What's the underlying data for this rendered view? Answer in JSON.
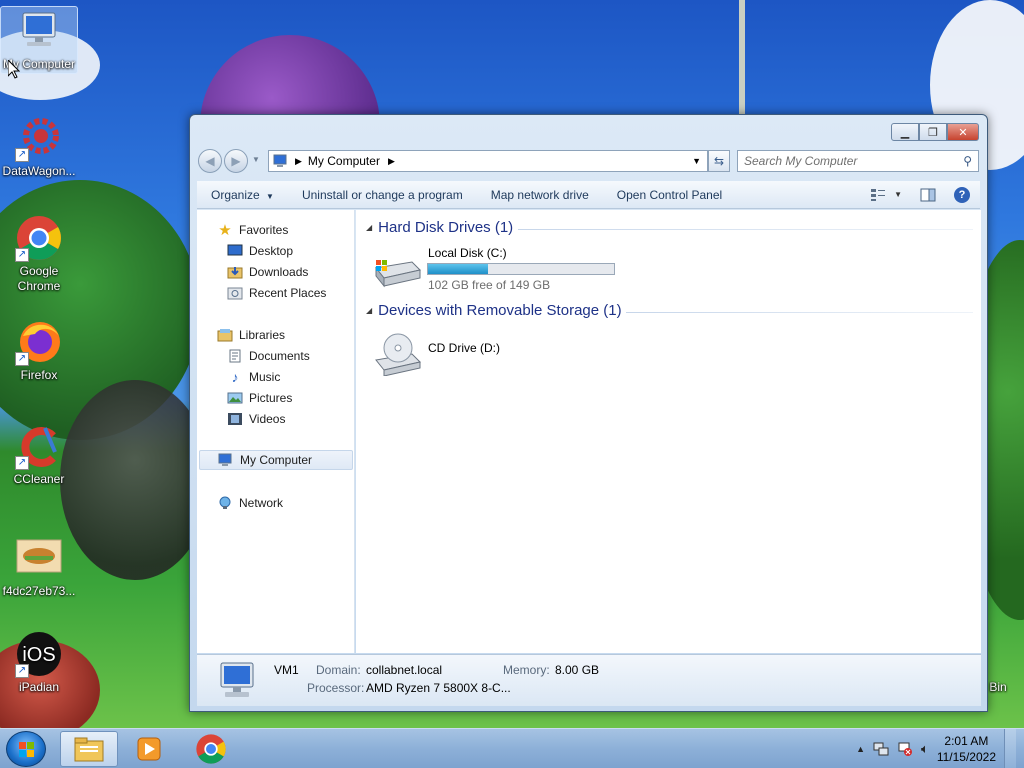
{
  "desktop": {
    "icons": [
      {
        "label": "My Computer"
      },
      {
        "label": "DataWagon..."
      },
      {
        "label": "Google"
      },
      {
        "label": "Chrome"
      },
      {
        "label": "Firefox"
      },
      {
        "label": "CCleaner"
      },
      {
        "label": "f4dc27eb73..."
      },
      {
        "label": "iPadian"
      }
    ],
    "recycle_partial": "Bin"
  },
  "window": {
    "address": {
      "path_segment": "My Computer"
    },
    "search": {
      "placeholder": "Search My Computer"
    },
    "toolbar": {
      "organize": "Organize",
      "uninstall": "Uninstall or change a program",
      "map_drive": "Map network drive",
      "control_panel": "Open Control Panel"
    },
    "nav": {
      "favorites": "Favorites",
      "desktop": "Desktop",
      "downloads": "Downloads",
      "recent": "Recent Places",
      "libraries": "Libraries",
      "documents": "Documents",
      "music": "Music",
      "pictures": "Pictures",
      "videos": "Videos",
      "computer": "My Computer",
      "network": "Network"
    },
    "content": {
      "hdd_group": "Hard Disk Drives (1)",
      "local_disk": {
        "name": "Local Disk (C:)",
        "free_text": "102 GB free of 149 GB",
        "used_fraction": 0.32
      },
      "removable_group": "Devices with Removable Storage (1)",
      "cd_drive": {
        "name": "CD Drive (D:)"
      }
    },
    "details": {
      "name": "VM1",
      "domain_label": "Domain:",
      "domain_value": "collabnet.local",
      "memory_label": "Memory:",
      "memory_value": "8.00 GB",
      "processor_label": "Processor:",
      "processor_value": "AMD Ryzen 7 5800X 8-C..."
    }
  },
  "taskbar": {
    "clock_time": "2:01 AM",
    "clock_date": "11/15/2022"
  },
  "colors": {
    "group_header": "#1e3287",
    "disk_bar_fill": "#26a0da",
    "taskbar": "#8db0d8"
  }
}
